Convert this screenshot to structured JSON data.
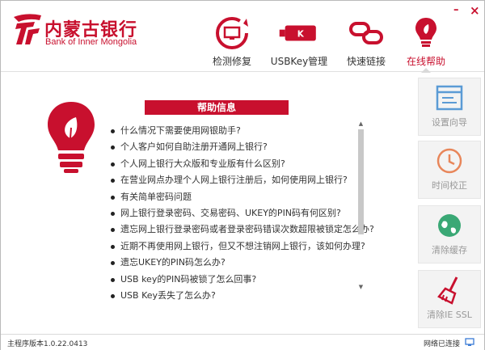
{
  "app": {
    "logo_cn": "内蒙古银行",
    "logo_en": "Bank of Inner Mongolia",
    "brand_color": "#c8102e"
  },
  "window_controls": {
    "minimize": "–",
    "close": "×"
  },
  "nav": [
    {
      "label": "检测修复",
      "icon": "monitor-refresh-icon"
    },
    {
      "label": "USBKey管理",
      "icon": "usbkey-icon"
    },
    {
      "label": "快速链接",
      "icon": "link-chain-icon"
    },
    {
      "label": "在线帮助",
      "icon": "lightbulb-icon",
      "active": true
    }
  ],
  "help": {
    "title": "帮助信息",
    "items": [
      "什么情况下需要使用网银助手?",
      "个人客户如何自助注册开通网上银行?",
      "个人网上银行大众版和专业版有什么区别?",
      "在营业网点办理个人网上银行注册后，如何使用网上银行?",
      "有关简单密码问题",
      "网上银行登录密码、交易密码、UKEY的PIN码有何区别?",
      "遗忘网上银行登录密码或者登录密码错误次数超限被锁定怎么办?",
      "近期不再使用网上银行，但又不想注销网上银行，该如何办理?",
      "遗忘UKEY的PIN码怎么办?",
      "USB key的PIN码被锁了怎么回事?",
      "USB Key丢失了怎么办?"
    ]
  },
  "side": [
    {
      "label": "设置向导",
      "icon": "settings-wizard-icon"
    },
    {
      "label": "时间校正",
      "icon": "clock-icon"
    },
    {
      "label": "清除缓存",
      "icon": "globe-icon"
    },
    {
      "label": "清除IE SSL",
      "icon": "broom-icon"
    }
  ],
  "status": {
    "version": "主程序版本1.0.22.0413",
    "network": "网络已连接"
  }
}
